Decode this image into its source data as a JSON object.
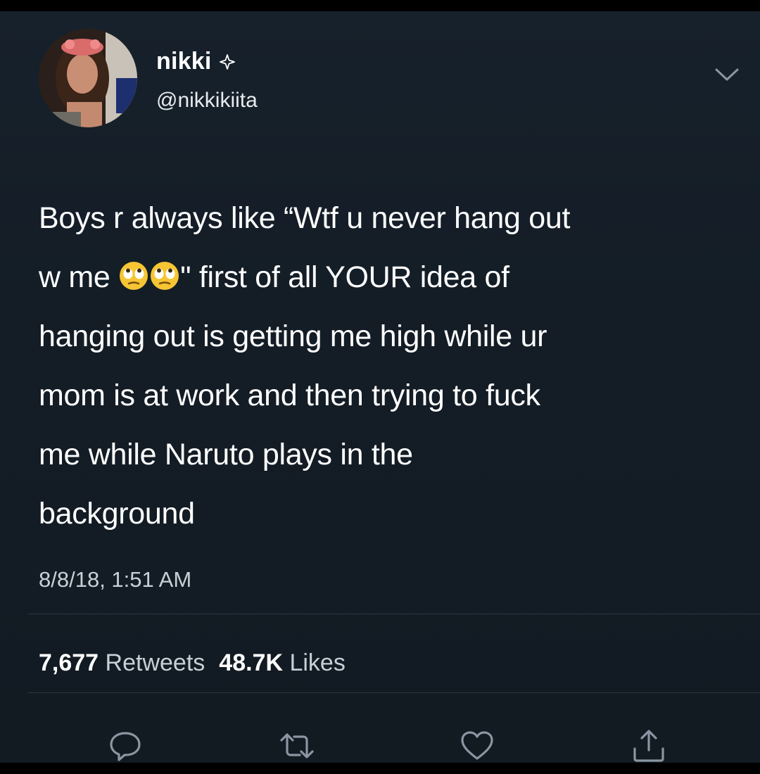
{
  "user": {
    "display_name": "nikki",
    "handle": "@nikkikiita",
    "badge_icon": "sparkle-icon",
    "menu_icon": "chevron-down-icon"
  },
  "tweet": {
    "lines": [
      "Boys r always like “Wtf u never hang out",
      "w me",
      "\" first of all YOUR idea of",
      "hanging out is getting me high while ur",
      "mom is at work and then trying to fuck",
      "me while Naruto plays in the",
      "background"
    ],
    "emoji": "face-with-rolling-eyes",
    "timestamp": "8/8/18, 1:51 AM"
  },
  "stats": {
    "retweets_count": "7,677",
    "retweets_label": "Retweets",
    "likes_count": "48.7K",
    "likes_label": "Likes"
  },
  "actions": [
    {
      "name": "reply-icon"
    },
    {
      "name": "retweet-icon"
    },
    {
      "name": "like-icon"
    },
    {
      "name": "share-icon"
    }
  ],
  "colors": {
    "background": "#141d26",
    "text_primary": "#ffffff",
    "text_secondary": "#c8d0d7",
    "divider": "#2c3640"
  }
}
